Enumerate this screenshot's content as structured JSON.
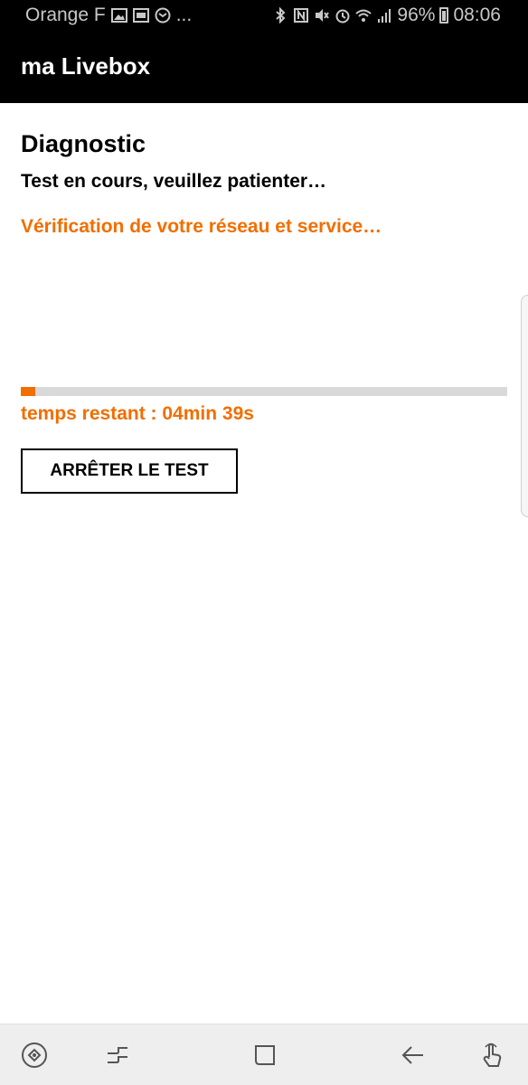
{
  "status_bar": {
    "carrier": "Orange F",
    "overflow": "...",
    "battery_percent": "96%",
    "time": "08:06",
    "left_icons": [
      "image-icon",
      "tv-icon",
      "message-icon"
    ],
    "right_icons": [
      "bluetooth-icon",
      "nfc-icon",
      "mute-icon",
      "alarm-icon",
      "wifi-icon",
      "signal-icon",
      "battery-icon"
    ]
  },
  "app_bar": {
    "title": "ma Livebox"
  },
  "diagnostic": {
    "title": "Diagnostic",
    "subtitle": "Test en cours, veuillez patienter…",
    "status": "Vérification de votre réseau et service…",
    "progress_fraction": 0.03,
    "remaining_time": "temps restant : 04min 39s",
    "stop_button_label": "ARRÊTER LE TEST"
  },
  "colors": {
    "accent": "#f16e00",
    "bar_background": "#000000",
    "track": "#d9d9d9"
  },
  "nav_bar": {
    "buttons": [
      "game-launcher-icon",
      "recent-apps-icon",
      "home-icon",
      "back-icon",
      "touch-gesture-icon"
    ]
  }
}
